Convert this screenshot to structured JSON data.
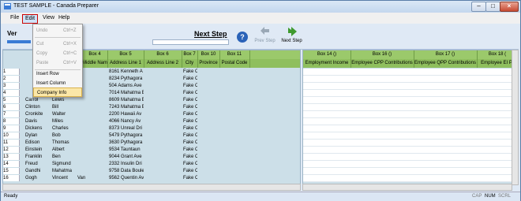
{
  "window": {
    "title": "TEST SAMPLE - Canada Preparer"
  },
  "menu": {
    "items": [
      "File",
      "Edit",
      "View",
      "Help"
    ]
  },
  "edit_menu": [
    {
      "label": "Undo",
      "shortcut": "Ctrl+Z",
      "disabled": true
    },
    {
      "label": "Cut",
      "shortcut": "Ctrl+X",
      "disabled": true
    },
    {
      "label": "Copy",
      "shortcut": "Ctrl+C",
      "disabled": true
    },
    {
      "label": "Paste",
      "shortcut": "Ctrl+V",
      "disabled": true
    },
    {
      "label": "Insert Row",
      "shortcut": "",
      "disabled": false
    },
    {
      "label": "Insert Column",
      "shortcut": "",
      "disabled": false
    },
    {
      "label": "Company Info",
      "shortcut": "",
      "disabled": false
    }
  ],
  "toolbar": {
    "ver_label": "Ver",
    "next_step_heading": "Next Step",
    "prev_step": "Prev Step",
    "next_step": "Next Step",
    "help_glyph": "?"
  },
  "left_grid": {
    "header_row1": [
      "Box 4",
      "Box 5",
      "Box 6",
      "Box 7",
      "Box 10",
      "Box 11"
    ],
    "header_row2": [
      "Middle Name",
      "Address Line 1",
      "Address Line 2",
      "City",
      "Province",
      "Postal Code"
    ],
    "rows": [
      {
        "n": "1",
        "last": "",
        "first": "",
        "mid": "",
        "addr": "8161 Kenneth A",
        "city": "Fake C"
      },
      {
        "n": "2",
        "last": "",
        "first": "",
        "mid": "",
        "addr": "8234 Pythagora",
        "city": "Fake C"
      },
      {
        "n": "3",
        "last": "",
        "first": "",
        "mid": "",
        "addr": "504 Adams Ave",
        "city": "Fake C"
      },
      {
        "n": "4",
        "last": "",
        "first": "",
        "mid": "",
        "addr": "7014 Mahatma E",
        "city": "Fake C"
      },
      {
        "n": "5",
        "last": "Carrol",
        "first": "Lewis",
        "mid": "",
        "addr": "8609 Mahatma E",
        "city": "Fake C"
      },
      {
        "n": "6",
        "last": "Clinton",
        "first": "Bill",
        "mid": "",
        "addr": "7243 Mahatma E",
        "city": "Fake C"
      },
      {
        "n": "7",
        "last": "Cronkite",
        "first": "Walter",
        "mid": "",
        "addr": "2200 Hawaii Av",
        "city": "Fake C"
      },
      {
        "n": "8",
        "last": "Davis",
        "first": "Miles",
        "mid": "",
        "addr": "4066 Nancy Av",
        "city": "Fake C"
      },
      {
        "n": "9",
        "last": "Dickens",
        "first": "Charles",
        "mid": "",
        "addr": "8373 Unreal Dri",
        "city": "Fake C"
      },
      {
        "n": "10",
        "last": "Dylan",
        "first": "Bob",
        "mid": "",
        "addr": "5479 Pythagora",
        "city": "Fake C"
      },
      {
        "n": "11",
        "last": "Edison",
        "first": "Thomas",
        "mid": "",
        "addr": "3630 Pythagora",
        "city": "Fake C"
      },
      {
        "n": "12",
        "last": "Einstein",
        "first": "Albert",
        "mid": "",
        "addr": "9534 Tauntaun",
        "city": "Fake C"
      },
      {
        "n": "13",
        "last": "Franklin",
        "first": "Ben",
        "mid": "",
        "addr": "9044 Grant Ave",
        "city": "Fake C"
      },
      {
        "n": "14",
        "last": "Freud",
        "first": "Sigmund",
        "mid": "",
        "addr": "2332 Insulin Dri",
        "city": "Fake C"
      },
      {
        "n": "15",
        "last": "Gandhi",
        "first": "Mahatma",
        "mid": "",
        "addr": "9758 Data Boule",
        "city": "Fake C"
      },
      {
        "n": "16",
        "last": "Gogh",
        "first": "Vincent",
        "mid": "Van",
        "addr": "9562 Quentin Av",
        "city": "Fake C"
      }
    ]
  },
  "right_grid": {
    "header_row1": [
      "Box 14 ()",
      "Box 16 ()",
      "Box 17 ()",
      "Box 18 ("
    ],
    "header_row2": [
      "Employment Income",
      "Employee CPP Contributions",
      "Employee QPP Contributions",
      "Employee EI Pr"
    ]
  },
  "status": {
    "text": "Ready",
    "indicators": [
      {
        "label": "CAP",
        "on": false
      },
      {
        "label": "NUM",
        "on": true
      },
      {
        "label": "SCRL",
        "on": false
      }
    ]
  }
}
